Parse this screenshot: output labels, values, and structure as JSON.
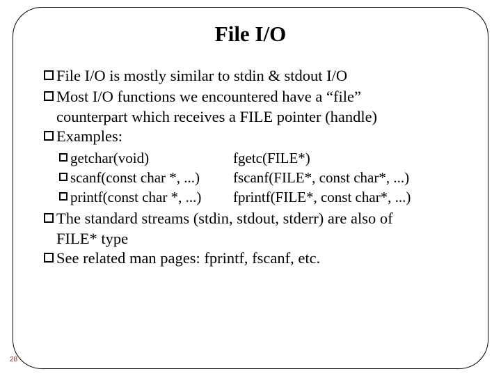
{
  "title": "File I/O",
  "bullets": {
    "b1": "File I/O is mostly similar to stdin & stdout I/O",
    "b2a": "Most I/O functions we encountered have a “file”",
    "b2b": "counterpart which receives a FILE pointer (handle)",
    "b3": "Examples:",
    "b4a": "The standard streams (stdin, stdout, stderr) are also of",
    "b4b": "FILE* type",
    "b5": "See related man pages: fprintf, fscanf, etc."
  },
  "examples": [
    {
      "left": "getchar(void)",
      "right": "fgetc(FILE*)"
    },
    {
      "left": "scanf(const char *, ...)",
      "right": "fscanf(FILE*, const char*, ...)"
    },
    {
      "left": "printf(const char *, ...)",
      "right": "fprintf(FILE*, const char*, ...)"
    }
  ],
  "page_number": "28"
}
